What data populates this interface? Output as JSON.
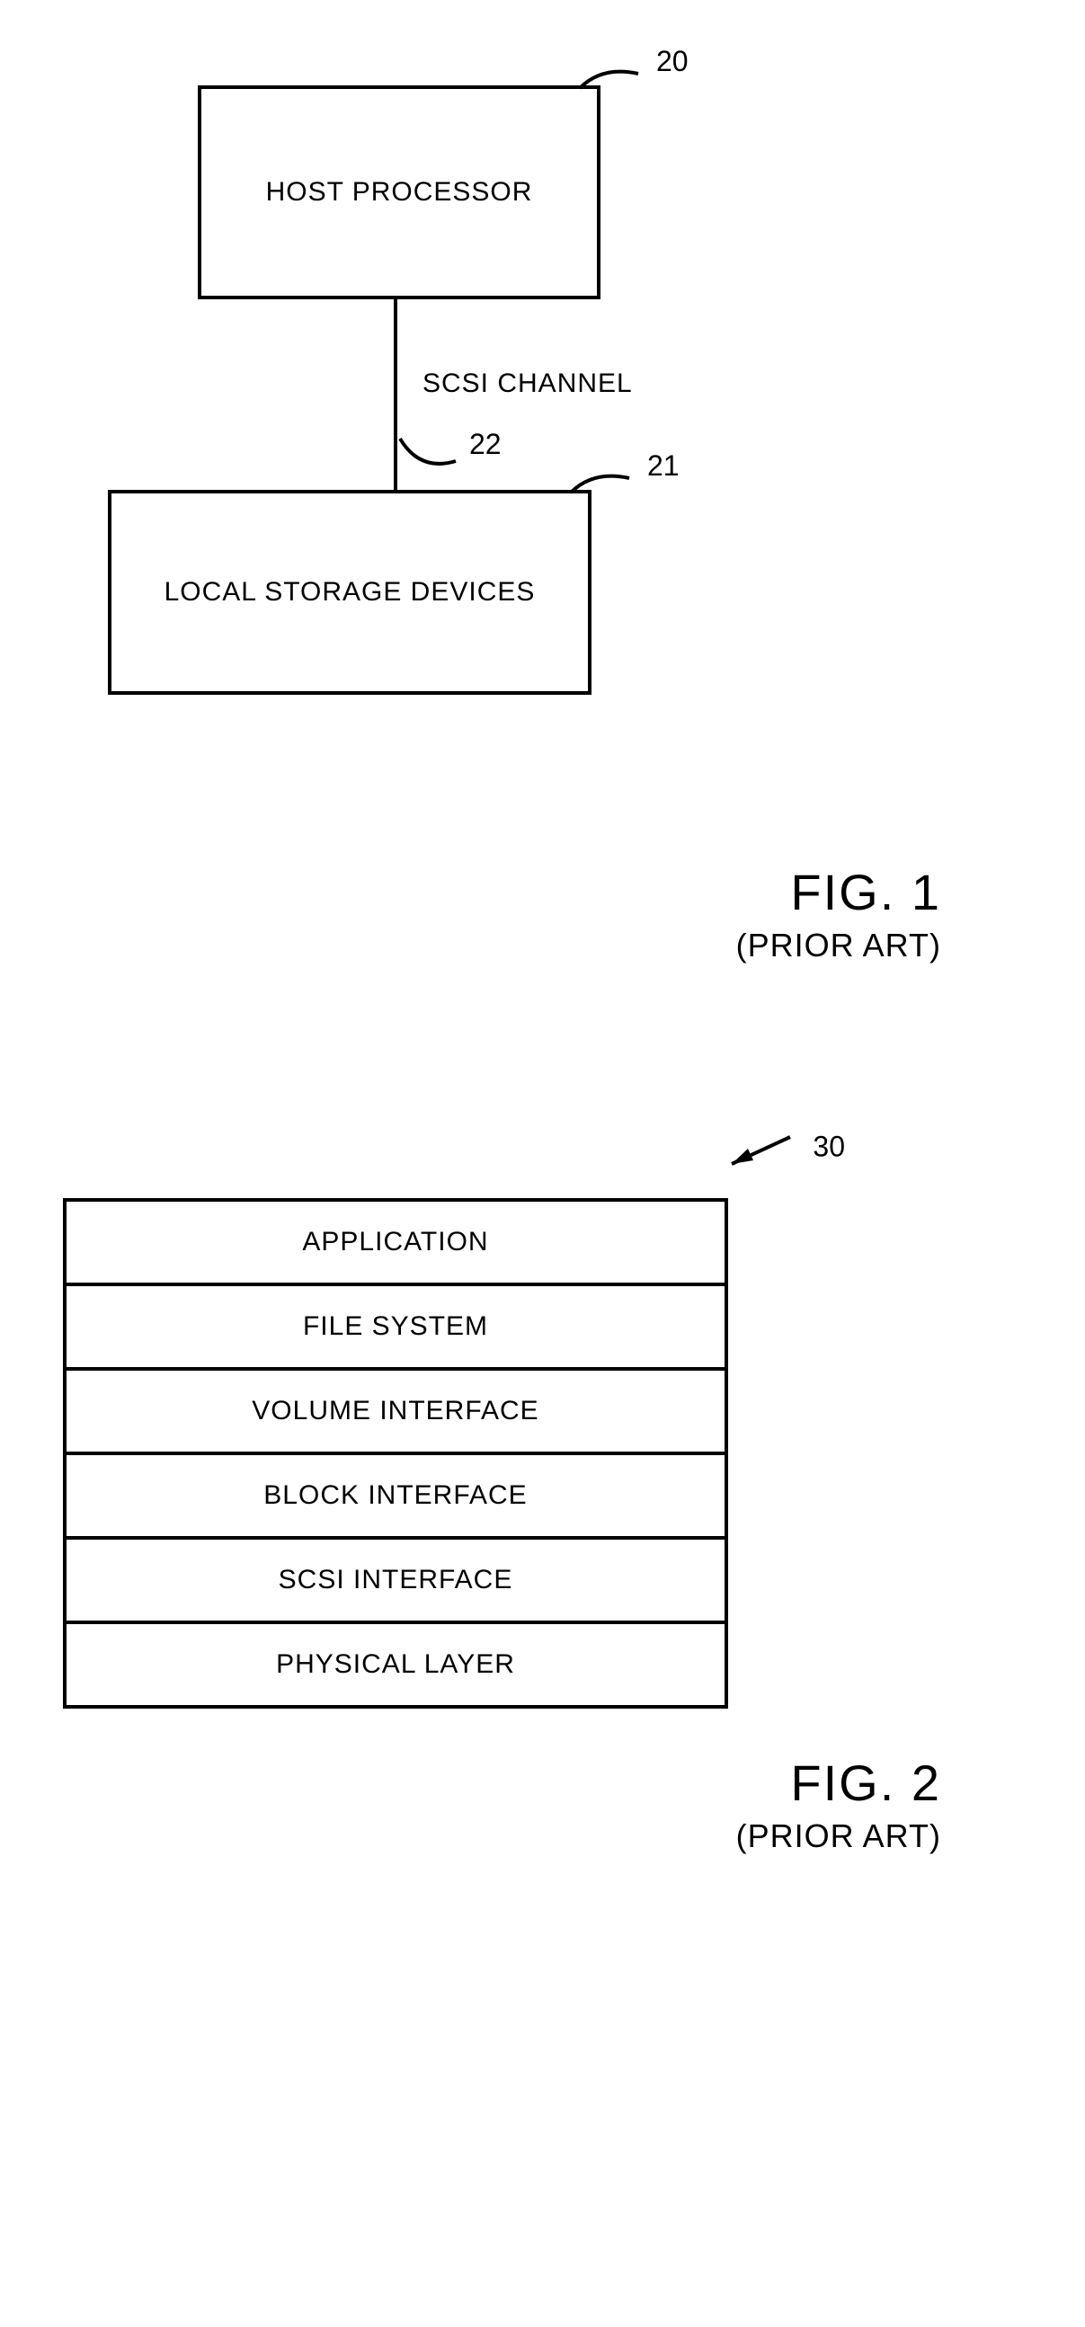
{
  "fig1": {
    "host_label": "HOST PROCESSOR",
    "storage_label": "LOCAL STORAGE DEVICES",
    "channel_label": "SCSI CHANNEL",
    "ref_host": "20",
    "ref_storage": "21",
    "ref_channel": "22",
    "caption": "FIG. 1",
    "prior_art": "(PRIOR ART)"
  },
  "fig2": {
    "ref": "30",
    "layers": [
      "APPLICATION",
      "FILE SYSTEM",
      "VOLUME INTERFACE",
      "BLOCK INTERFACE",
      "SCSI INTERFACE",
      "PHYSICAL LAYER"
    ],
    "caption": "FIG. 2",
    "prior_art": "(PRIOR ART)"
  }
}
